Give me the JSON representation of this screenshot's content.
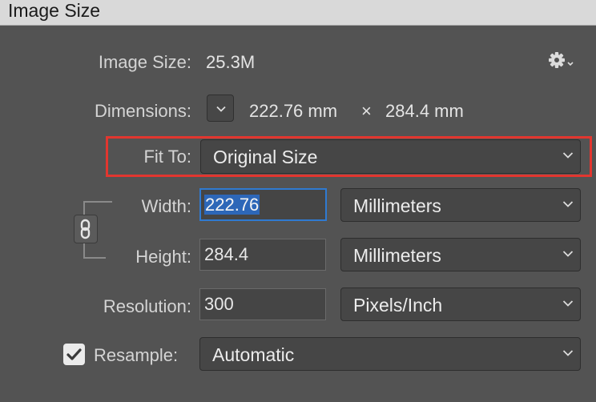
{
  "window": {
    "title": "Image Size"
  },
  "info": {
    "image_size_label": "Image Size:",
    "image_size_value": "25.3M",
    "dimensions_label": "Dimensions:",
    "dim_width": "222.76 mm",
    "dim_times": "×",
    "dim_height": "284.4 mm"
  },
  "fit_to": {
    "label": "Fit To:",
    "value": "Original Size"
  },
  "width": {
    "label": "Width:",
    "value": "222.76",
    "unit": "Millimeters"
  },
  "height": {
    "label": "Height:",
    "value": "284.4",
    "unit": "Millimeters"
  },
  "resolution": {
    "label": "Resolution:",
    "value": "300",
    "unit": "Pixels/Inch"
  },
  "resample": {
    "label": "Resample:",
    "checked": true,
    "value": "Automatic"
  },
  "icons": {
    "settings": "gear-icon",
    "dimensions_menu": "chevron-down-icon",
    "constrain": "link-chain-icon",
    "checkmark": "checkmark-icon"
  },
  "colors": {
    "dialog_bg": "#535353",
    "highlight_outline": "#e2362f",
    "focus_ring": "#2f7ad1",
    "text_selection": "#2d67b8"
  }
}
